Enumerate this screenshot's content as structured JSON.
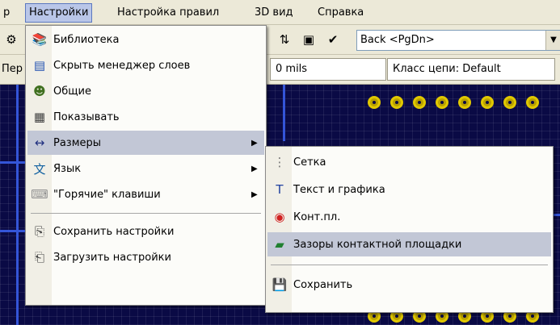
{
  "menubar": {
    "items": [
      {
        "label": "р"
      },
      {
        "label": "Настройки"
      },
      {
        "label": "Настройка правил"
      },
      {
        "label": "3D вид"
      },
      {
        "label": "Справка"
      }
    ]
  },
  "toolbar": {
    "layer_combo": "Back  <PgDn>",
    "left_partial": "Пер"
  },
  "toolbar2": {
    "width_field": "0 mils",
    "netclass_field": "Класс цепи: Default"
  },
  "settings_menu": {
    "items": [
      {
        "label": "Библиотека",
        "icon": "library-icon"
      },
      {
        "label": "Скрыть менеджер слоев",
        "icon": "layers-manager-icon"
      },
      {
        "label": "Общие",
        "icon": "general-icon"
      },
      {
        "label": "Показывать",
        "icon": "display-icon"
      },
      {
        "label": "Размеры",
        "icon": "dimensions-icon"
      },
      {
        "label": "Язык",
        "icon": "language-icon"
      },
      {
        "label": "\"Горячие\" клавиши",
        "icon": "hotkeys-icon"
      },
      {
        "label": "Сохранить настройки",
        "icon": "save-settings-icon"
      },
      {
        "label": "Загрузить настройки",
        "icon": "load-settings-icon"
      }
    ]
  },
  "dimensions_submenu": {
    "items": [
      {
        "label": "Сетка",
        "icon": "grid-icon"
      },
      {
        "label": "Текст и графика",
        "icon": "text-graphics-icon"
      },
      {
        "label": "Конт.пл.",
        "icon": "pad-icon"
      },
      {
        "label": "Зазоры контактной площадки",
        "icon": "pad-clearance-icon"
      },
      {
        "label": "Сохранить",
        "icon": "save-icon"
      }
    ]
  },
  "colors": {
    "highlight": "#c2c7d6",
    "menubar_active": "#b9c6e8",
    "canvas_bg": "#0a0a45"
  }
}
